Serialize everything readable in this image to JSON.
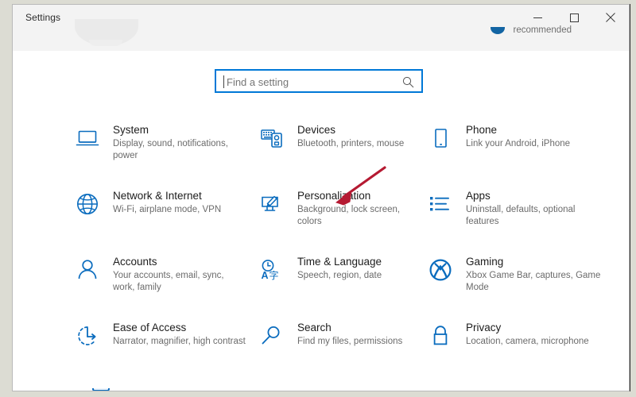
{
  "window": {
    "title": "Settings",
    "controls": [
      {
        "name": "minimize",
        "glyph": "minimize-icon"
      },
      {
        "name": "maximize",
        "glyph": "maximize-icon"
      },
      {
        "name": "close",
        "glyph": "close-icon"
      }
    ]
  },
  "header": {
    "recommended_label": "recommended",
    "accent_color": "#1264a3"
  },
  "search": {
    "placeholder": "Find a setting",
    "value": "",
    "icon": "search-icon",
    "border_color": "#0078d7"
  },
  "annotation": {
    "arrow_color": "#b51a32",
    "points_to": "Personalization"
  },
  "theme": {
    "icon_color": "#0a6cbe",
    "title_color": "#1d1d1d",
    "subtitle_color": "#6b6b6b",
    "window_background": "#ffffff",
    "desktop_background": "#dcdcd3"
  },
  "tiles": [
    {
      "icon": "laptop-icon",
      "title": "System",
      "subtitle": "Display, sound, notifications, power"
    },
    {
      "icon": "devices-icon",
      "title": "Devices",
      "subtitle": "Bluetooth, printers, mouse"
    },
    {
      "icon": "phone-icon",
      "title": "Phone",
      "subtitle": "Link your Android, iPhone"
    },
    {
      "icon": "globe-icon",
      "title": "Network & Internet",
      "subtitle": "Wi-Fi, airplane mode, VPN"
    },
    {
      "icon": "personalization-icon",
      "title": "Personalization",
      "subtitle": "Background, lock screen, colors"
    },
    {
      "icon": "apps-list-icon",
      "title": "Apps",
      "subtitle": "Uninstall, defaults, optional features"
    },
    {
      "icon": "person-icon",
      "title": "Accounts",
      "subtitle": "Your accounts, email, sync, work, family"
    },
    {
      "icon": "clock-language-icon",
      "title": "Time & Language",
      "subtitle": "Speech, region, date"
    },
    {
      "icon": "xbox-icon",
      "title": "Gaming",
      "subtitle": "Xbox Game Bar, captures, Game Mode"
    },
    {
      "icon": "ease-of-access-icon",
      "title": "Ease of Access",
      "subtitle": "Narrator, magnifier, high contrast"
    },
    {
      "icon": "search-magnifier-icon",
      "title": "Search",
      "subtitle": "Find my files, permissions"
    },
    {
      "icon": "lock-icon",
      "title": "Privacy",
      "subtitle": "Location, camera, microphone"
    }
  ]
}
